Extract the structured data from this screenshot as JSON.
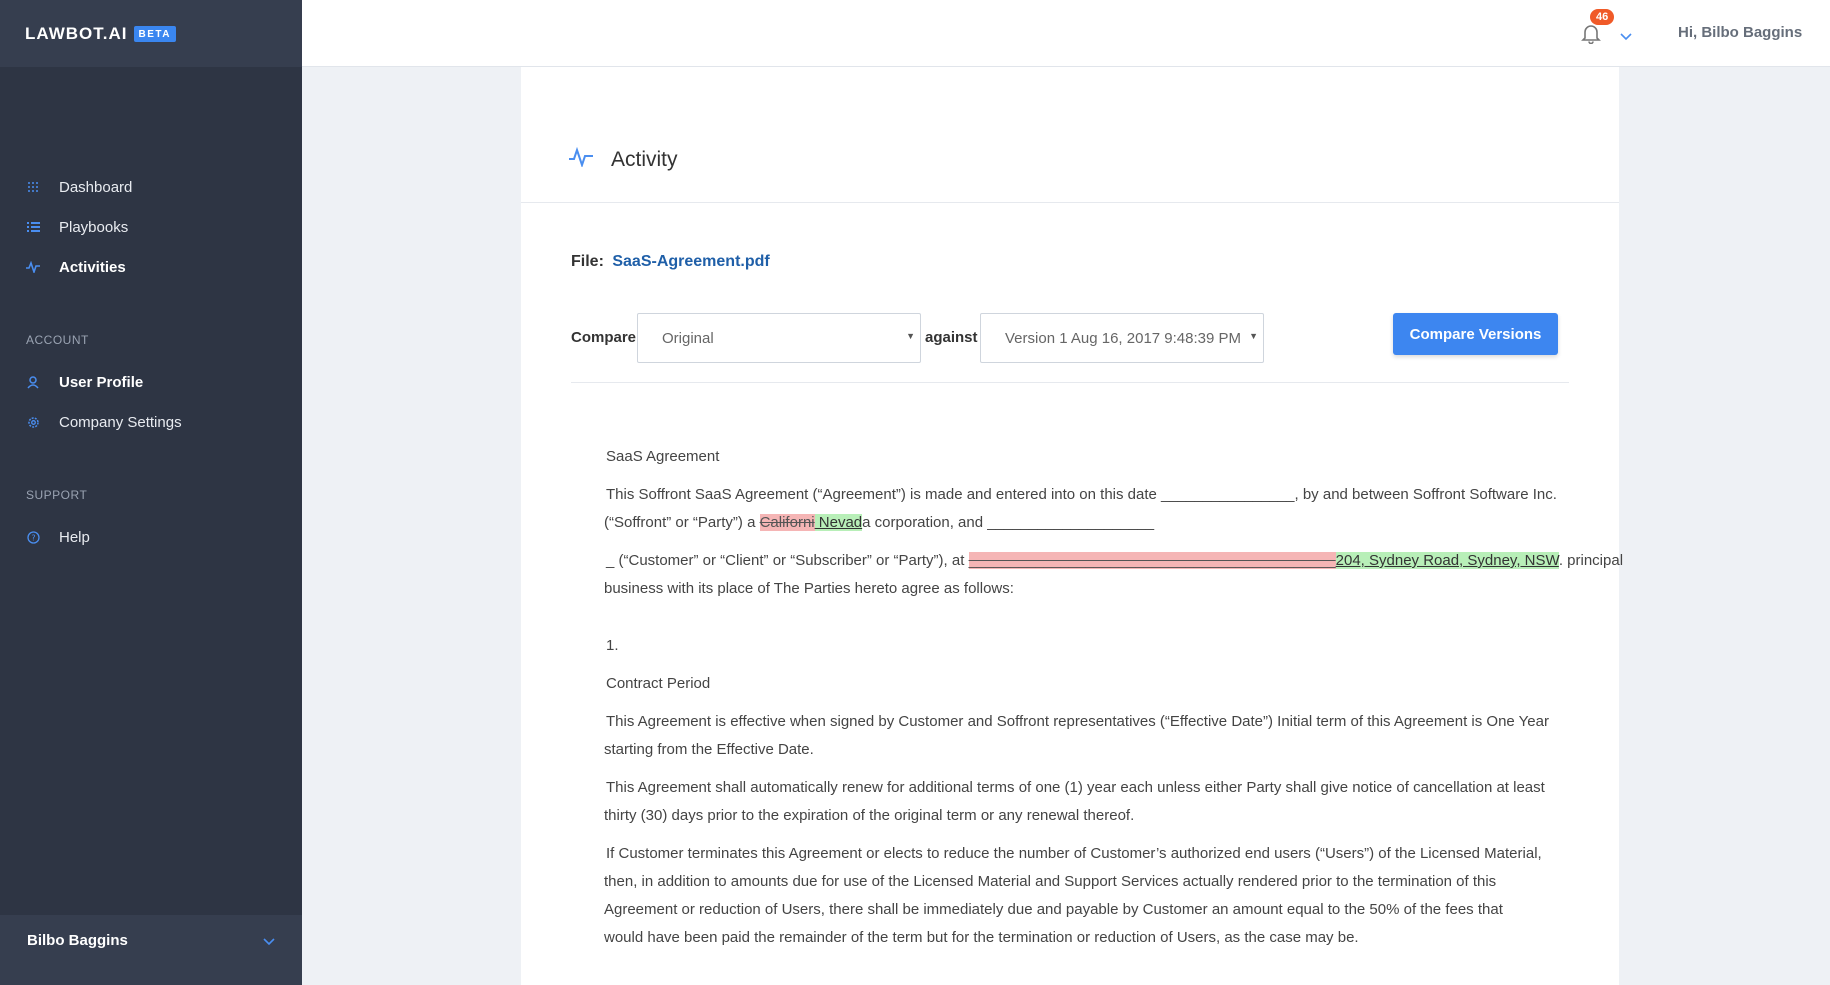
{
  "brand": {
    "name": "LAWBOT.AI",
    "tag": "BETA"
  },
  "nav": {
    "items": [
      {
        "label": "Dashboard",
        "icon": "grid-icon"
      },
      {
        "label": "Playbooks",
        "icon": "list-icon"
      },
      {
        "label": "Activities",
        "icon": "activity-icon"
      }
    ],
    "account_title": "ACCOUNT",
    "account_items": [
      {
        "label": "User Profile",
        "icon": "user-icon"
      },
      {
        "label": "Company Settings",
        "icon": "gear-icon"
      }
    ],
    "support_title": "SUPPORT",
    "support_items": [
      {
        "label": "Help",
        "icon": "help-icon"
      }
    ],
    "footer_user": "Bilbo Baggins"
  },
  "header": {
    "notification_count": "46",
    "greeting": "Hi, Bilbo Baggins"
  },
  "page": {
    "title": "Activity",
    "file_label": "File:",
    "file_name": "SaaS-Agreement.pdf",
    "compare_label": "Compare",
    "compare_value": "Original",
    "against_label": "against",
    "against_value": "Version 1 Aug 16, 2017 9:48:39 PM",
    "compare_button": "Compare Versions"
  },
  "document": {
    "heading": "SaaS Agreement",
    "p1_line1": "This Soffront SaaS Agreement (“Agreement”) is made and entered into on this date ________________, by and between Soffront Software Inc.",
    "p1_line2_pre": "(“Soffront” or “Party”) a ",
    "p1_line2_del": "Californi",
    "p1_line2_ins": " Nevad",
    "p1_line2_post": "a corporation, and ____________________",
    "p2_pre": "_ (“Customer” or “Client” or “Subscriber” or “Party”), at ",
    "p2_del": "____________________________________________",
    "p2_ins": "204, Sydney Road, Sydney, NSW",
    "p2_post": ". principal",
    "p2_line2": "business with its place of The Parties hereto agree as follows:",
    "item_number": "1.",
    "section_title": "Contract Period",
    "p3_line1": "This Agreement is effective when signed by Customer and Soffront representatives (“Effective Date”) Initial term of this Agreement is One Year",
    "p3_line2": "starting from the Effective Date.",
    "p4_line1": "This Agreement shall automatically renew for additional terms of one (1) year each unless either Party shall give notice of cancellation at least",
    "p4_line2": "thirty (30) days prior to the expiration of the original term or any renewal thereof.",
    "p5_line1": "If Customer terminates this Agreement or elects to reduce the number of Customer’s authorized end users (“Users”) of the Licensed Material,",
    "p5_line2": "then, in addition to amounts due for use of the Licensed Material and Support Services actually rendered prior to the termination of this",
    "p5_line3": "Agreement or reduction of Users, there shall be immediately due and payable by Customer an amount equal to the 50% of the fees that",
    "p5_line4": "would have been paid the remainder of the term but for the termination or reduction of Users, as the case may be."
  }
}
